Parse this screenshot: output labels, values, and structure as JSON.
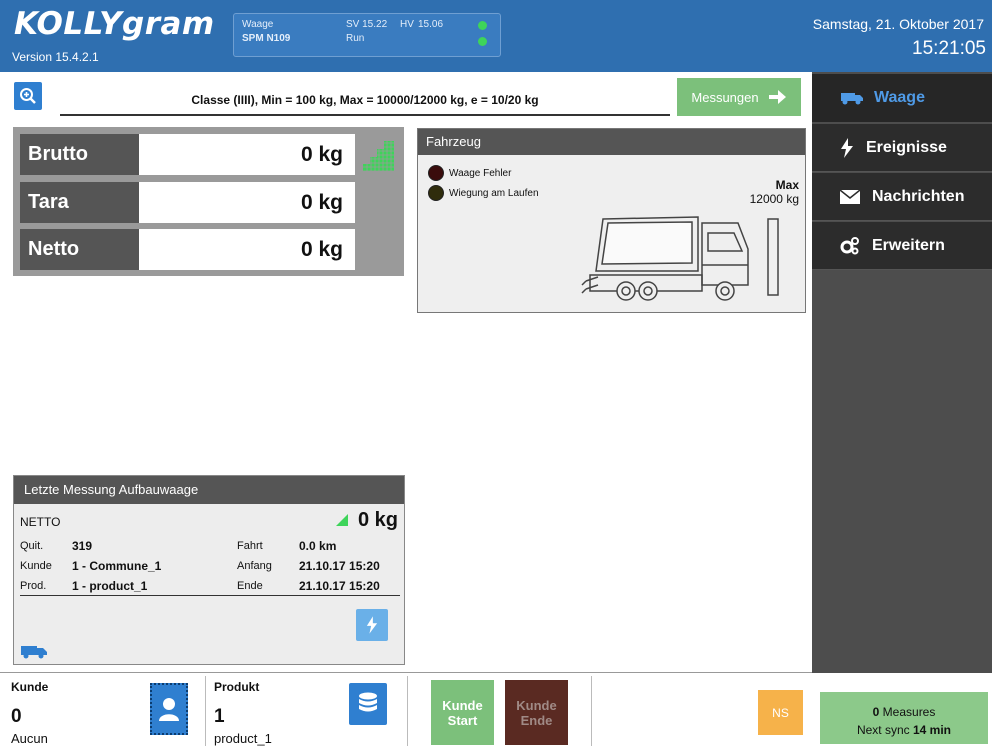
{
  "header": {
    "logo": "KOLLYgram",
    "version": "Version 15.4.2.1",
    "status": {
      "device_label": "Waage",
      "device_id": "SPM N109",
      "sv": "SV 15.22",
      "hv": "HV",
      "hv_value": "15.06",
      "state": "Run"
    },
    "date": "Samstag, 21. Oktober 2017",
    "time": "15:21:05"
  },
  "topbar": {
    "classe": "Classe (IIII), Min = 100 kg, Max = 10000/12000 kg, e = 10/20 kg",
    "messungen_label": "Messungen"
  },
  "weights": {
    "brutto_label": "Brutto",
    "brutto_value": "0 kg",
    "tara_label": "Tara",
    "tara_value": "0 kg",
    "netto_label": "Netto",
    "netto_value": "0 kg"
  },
  "vehicle": {
    "title": "Fahrzeug",
    "lamp1": "Waage Fehler",
    "lamp2": "Wiegung am Laufen",
    "max_label": "Max",
    "max_value": "12000 kg"
  },
  "sidebar": {
    "items": [
      {
        "label": "Waage"
      },
      {
        "label": "Ereignisse"
      },
      {
        "label": "Nachrichten"
      },
      {
        "label": "Erweitern"
      }
    ]
  },
  "last": {
    "title": "Letzte Messung Aufbauwaage",
    "netto_label": "NETTO",
    "netto_value": "0 kg",
    "quit_label": "Quit.",
    "quit_value": "319",
    "kunde_label": "Kunde",
    "kunde_value": "1 - Commune_1",
    "prod_label": "Prod.",
    "prod_value": "1 - product_1",
    "fahrt_label": "Fahrt",
    "fahrt_value": "0.0 km",
    "anfang_label": "Anfang",
    "anfang_value": "21.10.17 15:20",
    "ende_label": "Ende",
    "ende_value": "21.10.17 15:20"
  },
  "bottom": {
    "kunde_label": "Kunde",
    "kunde_value": "0",
    "kunde_name": "Aucun",
    "produkt_label": "Produkt",
    "produkt_value": "1",
    "produkt_name": "product_1",
    "kunde_start_line1": "Kunde",
    "kunde_start_line2": "Start",
    "kunde_ende_line1": "Kunde",
    "kunde_ende_line2": "Ende",
    "ns_label": "NS",
    "sync_count": "0",
    "sync_measures": "Measures",
    "sync_next": "Next sync",
    "sync_time": "14 min"
  },
  "colors": {
    "header_blue": "#2f6fb0",
    "accent_green": "#7cc07b",
    "signal_green": "#3ed45a",
    "ende_brown": "#5a2a22",
    "ns_orange": "#f6b24a"
  }
}
